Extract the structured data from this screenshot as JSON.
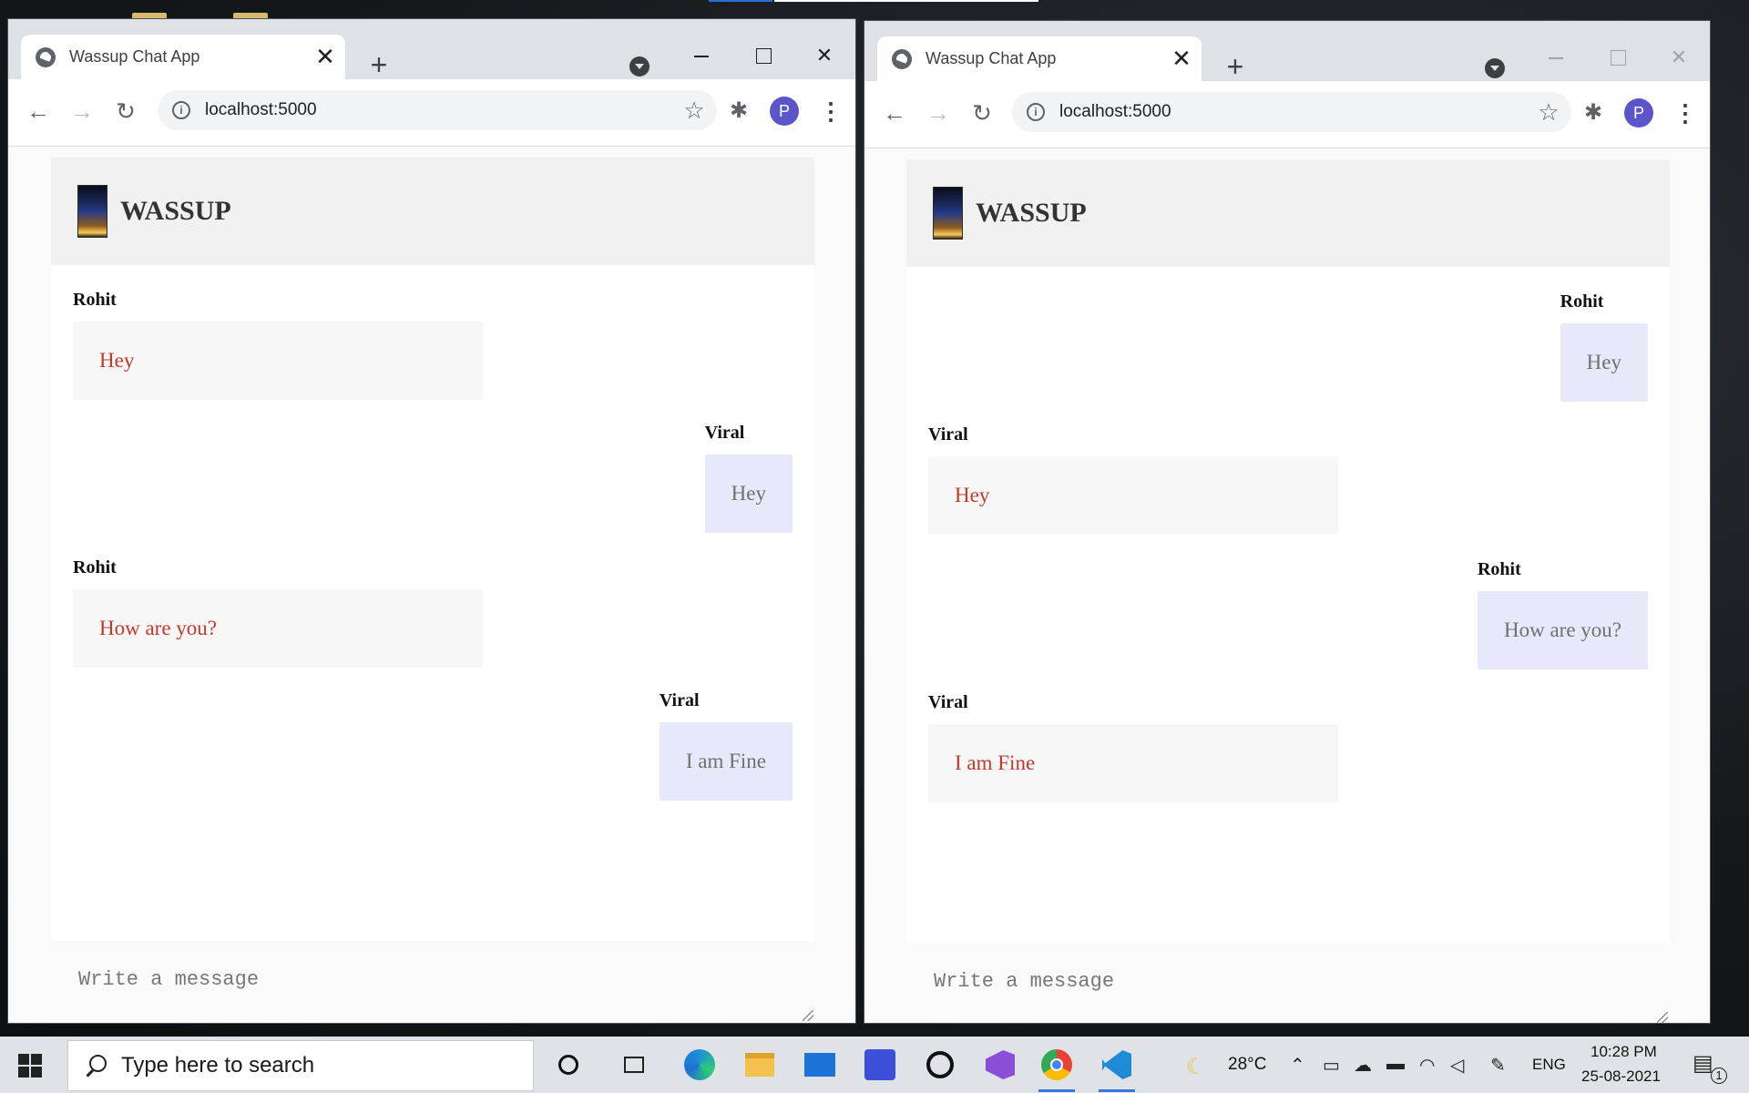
{
  "browser": {
    "tab_title": "Wassup Chat App",
    "tab_close": "✕",
    "new_tab": "+",
    "url": "localhost:5000",
    "profile_initial": "P"
  },
  "chat": {
    "brand": "WASSUP",
    "placeholder": "Write a message"
  },
  "window_left": {
    "messages": [
      {
        "sender": "Rohit",
        "text": "Hey",
        "side": "incoming"
      },
      {
        "sender": "Viral",
        "text": "Hey",
        "side": "outgoing"
      },
      {
        "sender": "Rohit",
        "text": "How are you?",
        "side": "incoming"
      },
      {
        "sender": "Viral",
        "text": "I am Fine",
        "side": "outgoing"
      }
    ]
  },
  "window_right": {
    "messages": [
      {
        "sender": "Rohit",
        "text": "Hey",
        "side": "outgoing"
      },
      {
        "sender": "Viral",
        "text": "Hey",
        "side": "incoming"
      },
      {
        "sender": "Rohit",
        "text": "How are you?",
        "side": "outgoing"
      },
      {
        "sender": "Viral",
        "text": "I am Fine",
        "side": "incoming"
      }
    ]
  },
  "taskbar": {
    "search_placeholder": "Type here to search",
    "weather": "28°C",
    "language": "ENG",
    "time": "10:28 PM",
    "date": "25-08-2021",
    "notification_count": "1"
  },
  "icons": {
    "globe": "globe-icon",
    "back": "arrow-left-icon",
    "forward": "arrow-right-icon",
    "reload": "reload-icon",
    "info": "info-icon",
    "star": "star-icon",
    "extensions": "puzzle-icon",
    "menu": "more-vertical-icon"
  },
  "colors": {
    "incoming_text": "#c0392b",
    "outgoing_bubble": "#e8e8fb",
    "profile": "#5a56c9"
  }
}
